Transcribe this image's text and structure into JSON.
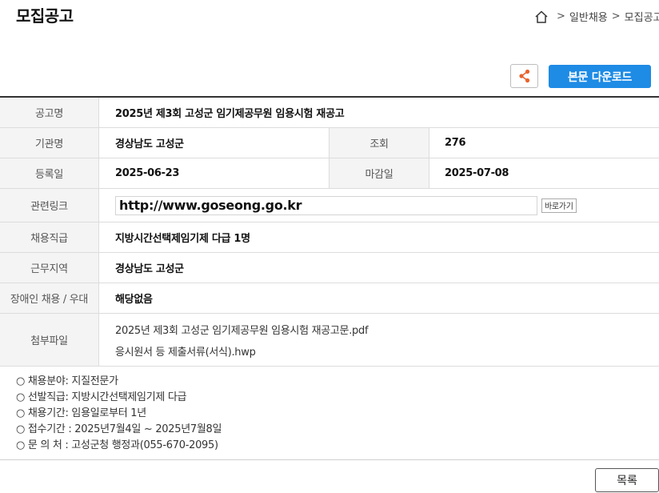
{
  "page_title": "모집공고",
  "breadcrumb": {
    "items": [
      "일반채용",
      "모집공고"
    ],
    "separator": ">"
  },
  "buttons": {
    "download": "본문 다운로드",
    "list": "목록",
    "go": "바로가기"
  },
  "colors": {
    "accent": "#1e8be5",
    "share_icon": "#e8632c"
  },
  "details": {
    "title_label": "공고명",
    "title": "2025년 제3회 고성군 임기제공무원 임용시험 재공고",
    "agency_label": "기관명",
    "agency": "경상남도 고성군",
    "views_label": "조회",
    "views": "276",
    "reg_label": "등록일",
    "reg_date": "2025-06-23",
    "deadline_label": "마감일",
    "deadline": "2025-07-08",
    "link_label": "관련링크",
    "link": "http://www.goseong.go.kr",
    "position_label": "채용직급",
    "position": "지방시간선택제임기제 다급 1명",
    "location_label": "근무지역",
    "location": "경상남도 고성군",
    "disability_label": "장애인 채용 / 우대",
    "disability": "해당없음",
    "files_label": "첨부파일",
    "files": [
      "2025년 제3회 고성군 임기제공무원 임용시험 재공고문.pdf",
      "응시원서 등 제출서류(서식).hwp"
    ]
  },
  "notes": [
    "○ 채용분야: 지질전문가",
    "○ 선발직급: 지방시간선택제임기제 다급",
    "○ 채용기간: 임용일로부터 1년",
    "○ 접수기간 : 2025년7월4일 ~ 2025년7월8일",
    "○ 문 의 처 : 고성군청 행정과(055-670-2095)"
  ]
}
